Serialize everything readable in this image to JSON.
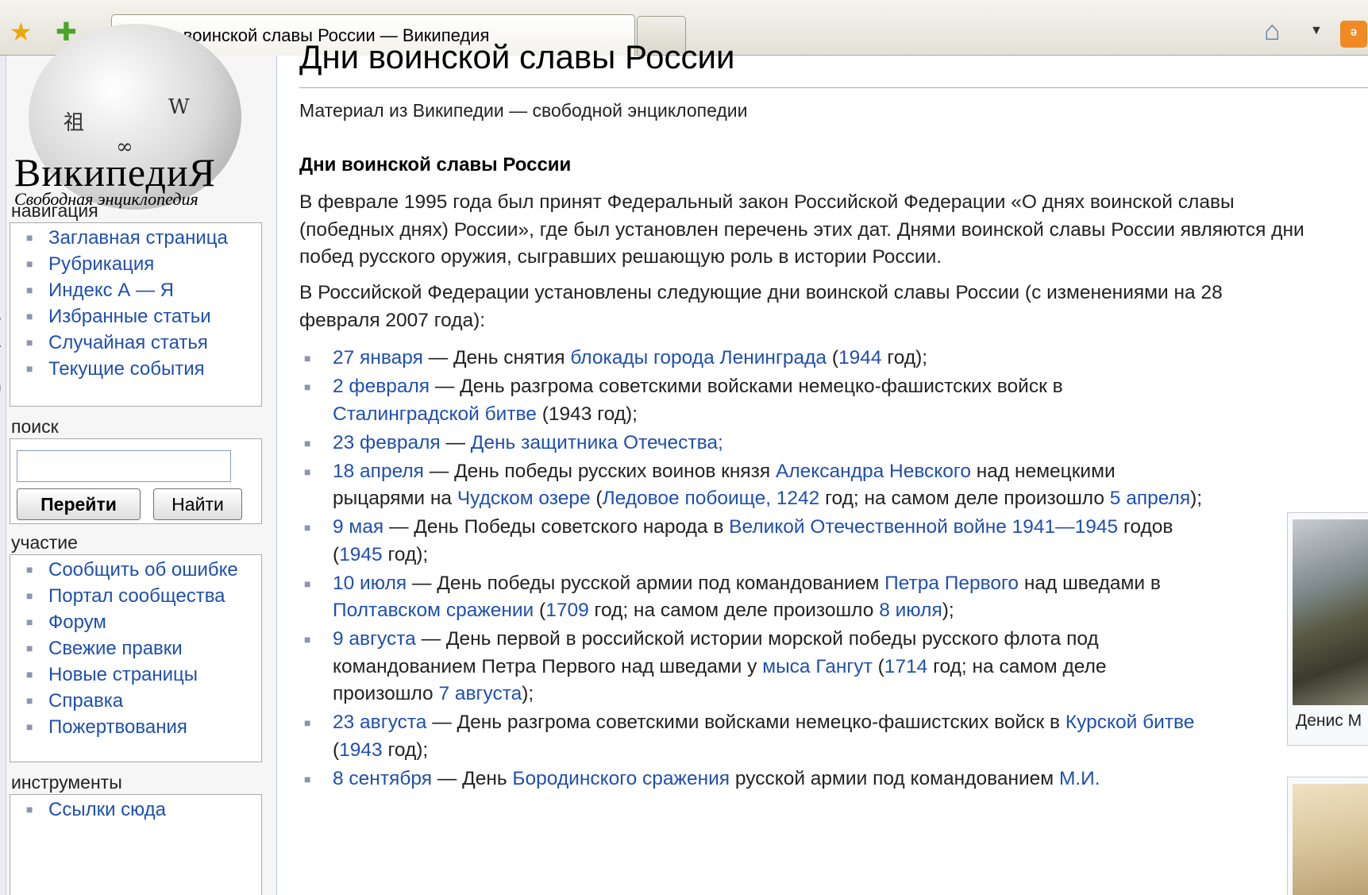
{
  "browser": {
    "tab_title": "Дни воинской славы России — Википедия",
    "tab_favicon": "W"
  },
  "sidebar": {
    "logo_title": "ВикипедиЯ",
    "logo_subtitle": "Свободная энциклопедия",
    "navigation_heading": "навигация",
    "navigation": [
      "Заглавная страница",
      "Рубрикация",
      "Индекс А — Я",
      "Избранные статьи",
      "Случайная статья",
      "Текущие события"
    ],
    "search_heading": "поиск",
    "search_value": "",
    "go_label": "Перейти",
    "find_label": "Найти",
    "participation_heading": "участие",
    "participation": [
      "Сообщить об ошибке",
      "Портал сообщества",
      "Форум",
      "Свежие правки",
      "Новые страницы",
      "Справка",
      "Пожертвования"
    ],
    "tools_heading": "инструменты",
    "tools": [
      "Ссылки сюда"
    ]
  },
  "content": {
    "page_title": "Дни воинской славы России",
    "site_sub": "Материал из Википедии — свободной энциклопедии",
    "section_heading": "Дни воинской славы России",
    "paragraph1": "В феврале 1995 года был принят Федеральный закон Российской Федерации «О днях воинской славы (победных днях) России», где был установлен перечень этих дат. Днями воинской славы России являются дни побед русского оружия, сыгравших решающую роль в истории России.",
    "paragraph2": "В Российской Федерации установлены следующие дни воинской славы России (с изменениями на 28 февраля 2007 года):",
    "days": [
      [
        {
          "t": "27 января",
          "l": true
        },
        {
          "t": " — День снятия "
        },
        {
          "t": "блокады города Ленинграда",
          "l": true
        },
        {
          "t": " ("
        },
        {
          "t": "1944",
          "l": true
        },
        {
          "t": " год);"
        }
      ],
      [
        {
          "t": "2 февраля",
          "l": true
        },
        {
          "t": " — День разгрома советскими войсками немецко-фашистских войск в "
        },
        {
          "t": "Сталинградской битве",
          "l": true
        },
        {
          "t": " (1943 год);"
        }
      ],
      [
        {
          "t": "23 февраля",
          "l": true
        },
        {
          "t": " — "
        },
        {
          "t": "День защитника Отечества;",
          "l": true
        }
      ],
      [
        {
          "t": "18 апреля",
          "l": true
        },
        {
          "t": " — День победы русских воинов князя "
        },
        {
          "t": "Александра Невского",
          "l": true
        },
        {
          "t": " над немецкими рыцарями на "
        },
        {
          "t": "Чудском озере",
          "l": true
        },
        {
          "t": " ("
        },
        {
          "t": "Ледовое побоище, 1242",
          "l": true
        },
        {
          "t": " год; на самом деле произошло "
        },
        {
          "t": "5 апреля",
          "l": true
        },
        {
          "t": ");"
        }
      ],
      [
        {
          "t": "9 мая",
          "l": true
        },
        {
          "t": " — День Победы советского народа в "
        },
        {
          "t": "Великой Отечественной войне 1941—1945",
          "l": true
        },
        {
          "t": " годов ("
        },
        {
          "t": "1945",
          "l": true
        },
        {
          "t": " год);"
        }
      ],
      [
        {
          "t": "10 июля",
          "l": true
        },
        {
          "t": " — День победы русской армии под командованием "
        },
        {
          "t": "Петра Первого",
          "l": true
        },
        {
          "t": " над шведами в "
        },
        {
          "t": "Полтавском сражении",
          "l": true
        },
        {
          "t": " ("
        },
        {
          "t": "1709",
          "l": true
        },
        {
          "t": " год; на самом деле произошло "
        },
        {
          "t": "8 июля",
          "l": true
        },
        {
          "t": ");"
        }
      ],
      [
        {
          "t": "9 августа",
          "l": true
        },
        {
          "t": " — День первой в российской истории морской победы русского флота под командованием Петра Первого над шведами у "
        },
        {
          "t": "мыса Гангут",
          "l": true
        },
        {
          "t": " ("
        },
        {
          "t": "1714",
          "l": true
        },
        {
          "t": " год; на самом деле произошло "
        },
        {
          "t": "7 августа",
          "l": true
        },
        {
          "t": ");"
        }
      ],
      [
        {
          "t": "23 августа",
          "l": true
        },
        {
          "t": " — День разгрома советскими войсками немецко-фашистских войск в "
        },
        {
          "t": "Курской битве",
          "l": true
        },
        {
          "t": " ("
        },
        {
          "t": "1943",
          "l": true
        },
        {
          "t": " год);"
        }
      ],
      [
        {
          "t": "8 сентября",
          "l": true
        },
        {
          "t": " — День "
        },
        {
          "t": "Бородинского сражения",
          "l": true
        },
        {
          "t": " русской армии под командованием "
        },
        {
          "t": "М.И.",
          "l": true
        }
      ]
    ],
    "thumb1_caption": "Денис М"
  }
}
